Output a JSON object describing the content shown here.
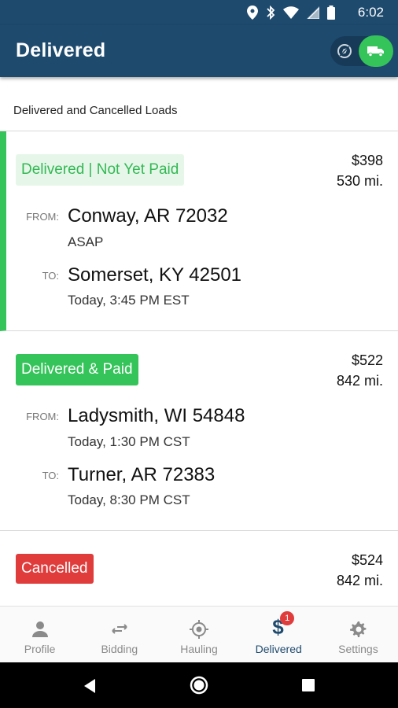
{
  "status_bar": {
    "time": "6:02"
  },
  "header": {
    "title": "Delivered"
  },
  "subheader": {
    "text": "Delivered and Cancelled Loads"
  },
  "loads": [
    {
      "status": "Delivered | Not Yet Paid",
      "price": "$398",
      "miles": "530 mi.",
      "from_label": "FROM:",
      "from_city": "Conway, AR 72032",
      "from_time": "ASAP",
      "to_label": "TO:",
      "to_city": "Somerset, KY 42501",
      "to_time": "Today, 3:45 PM EST"
    },
    {
      "status": "Delivered & Paid",
      "price": "$522",
      "miles": "842 mi.",
      "from_label": "FROM:",
      "from_city": "Ladysmith, WI 54848",
      "from_time": "Today, 1:30 PM CST",
      "to_label": "TO:",
      "to_city": "Turner, AR 72383",
      "to_time": "Today, 8:30 PM CST"
    },
    {
      "status": "Cancelled",
      "price": "$524",
      "miles": "842 mi."
    }
  ],
  "nav": {
    "profile": "Profile",
    "bidding": "Bidding",
    "hauling": "Hauling",
    "delivered": "Delivered",
    "delivered_dollar": "$",
    "delivered_badge": "1",
    "settings": "Settings"
  },
  "colors": {
    "primary": "#1e4a6e",
    "green": "#35c45a",
    "red": "#e03c3c"
  }
}
